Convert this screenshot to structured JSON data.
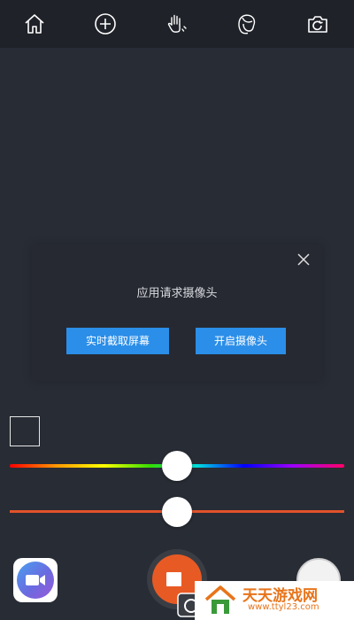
{
  "toolbar": {
    "icons": [
      "home-icon",
      "add-circle-icon",
      "hand-gesture-icon",
      "face-outline-icon",
      "switch-camera-icon"
    ]
  },
  "dialog": {
    "title": "应用请求摄像头",
    "capture_button": "实时截取屏幕",
    "camera_button": "开启摄像头"
  },
  "controls": {
    "hue_position": 0.5,
    "size_position": 0.5,
    "swatch_color": "#282c35",
    "size_track_color": "#e0522b"
  },
  "bottom": {
    "record_color": "#e85a24",
    "app_icon": "zoom-camera-icon"
  },
  "watermark": {
    "name": "天天游戏网",
    "url": "www.ttyl23.com"
  }
}
